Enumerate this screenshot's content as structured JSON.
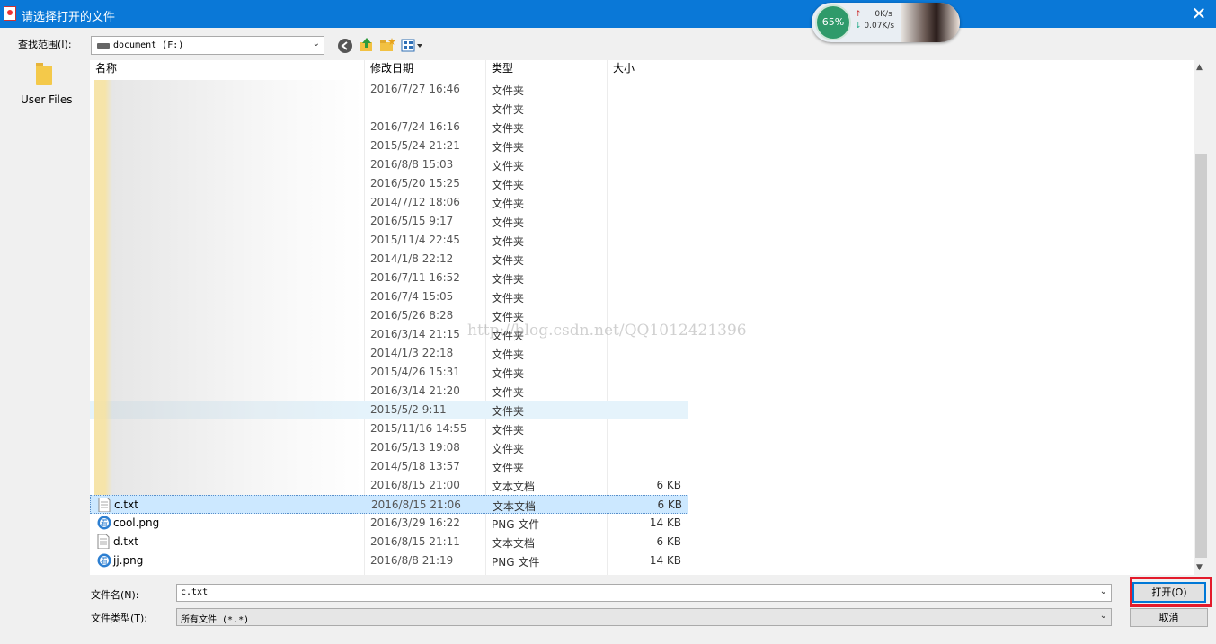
{
  "window": {
    "title": "请选择打开的文件",
    "close_glyph": "✕"
  },
  "net_widget": {
    "percent": "65%",
    "up_speed": "0K/s",
    "down_speed": "0.07K/s",
    "up_arrow": "↑",
    "down_arrow": "↓"
  },
  "toolbar": {
    "look_in_label": "查找范围(I):",
    "look_in_value": "document (F:)"
  },
  "places": {
    "items": [
      {
        "label": "User Files",
        "icon": "folder-icon"
      }
    ]
  },
  "columns": {
    "name": "名称",
    "date": "修改日期",
    "type": "类型",
    "size": "大小"
  },
  "files": [
    {
      "name": "",
      "date": "2016/7/27 16:46",
      "type": "文件夹",
      "size": "",
      "icon": "folder-icon"
    },
    {
      "name": "",
      "date": "",
      "type": "文件夹",
      "size": "",
      "icon": "folder-icon"
    },
    {
      "name": "",
      "date": "2016/7/24 16:16",
      "type": "文件夹",
      "size": "",
      "icon": "folder-icon"
    },
    {
      "name": "",
      "date": "2015/5/24 21:21",
      "type": "文件夹",
      "size": "",
      "icon": "folder-icon"
    },
    {
      "name": "",
      "date": "2016/8/8 15:03",
      "type": "文件夹",
      "size": "",
      "icon": "folder-icon"
    },
    {
      "name": "",
      "date": "2016/5/20 15:25",
      "type": "文件夹",
      "size": "",
      "icon": "folder-icon"
    },
    {
      "name": "",
      "date": "2014/7/12 18:06",
      "type": "文件夹",
      "size": "",
      "icon": "folder-icon"
    },
    {
      "name": "",
      "date": "2016/5/15 9:17",
      "type": "文件夹",
      "size": "",
      "icon": "folder-icon"
    },
    {
      "name": "",
      "date": "2015/11/4 22:45",
      "type": "文件夹",
      "size": "",
      "icon": "folder-icon"
    },
    {
      "name": "",
      "date": "2014/1/8 22:12",
      "type": "文件夹",
      "size": "",
      "icon": "folder-icon"
    },
    {
      "name": "",
      "date": "2016/7/11 16:52",
      "type": "文件夹",
      "size": "",
      "icon": "folder-icon"
    },
    {
      "name": "",
      "date": "2016/7/4 15:05",
      "type": "文件夹",
      "size": "",
      "icon": "folder-icon"
    },
    {
      "name": "",
      "date": "2016/5/26 8:28",
      "type": "文件夹",
      "size": "",
      "icon": "folder-icon"
    },
    {
      "name": "",
      "date": "2016/3/14 21:15",
      "type": "文件夹",
      "size": "",
      "icon": "folder-icon"
    },
    {
      "name": "",
      "date": "2014/1/3 22:18",
      "type": "文件夹",
      "size": "",
      "icon": "folder-icon"
    },
    {
      "name": "",
      "date": "2015/4/26 15:31",
      "type": "文件夹",
      "size": "",
      "icon": "folder-icon"
    },
    {
      "name": "",
      "date": "2016/3/14 21:20",
      "type": "文件夹",
      "size": "",
      "icon": "folder-icon"
    },
    {
      "name": "",
      "date": "2015/5/2 9:11",
      "type": "文件夹",
      "size": "",
      "icon": "folder-icon",
      "state": "hover"
    },
    {
      "name": "",
      "date": "2015/11/16 14:55",
      "type": "文件夹",
      "size": "",
      "icon": "folder-icon"
    },
    {
      "name": "",
      "date": "2016/5/13 19:08",
      "type": "文件夹",
      "size": "",
      "icon": "folder-icon"
    },
    {
      "name": "",
      "date": "2014/5/18 13:57",
      "type": "文件夹",
      "size": "",
      "icon": "folder-icon"
    },
    {
      "name": "",
      "date": "2016/8/15 21:00",
      "type": "文本文档",
      "size": "6 KB",
      "icon": "text-file-icon"
    },
    {
      "name": "c.txt",
      "date": "2016/8/15 21:06",
      "type": "文本文档",
      "size": "6 KB",
      "icon": "text-file-icon",
      "state": "selected"
    },
    {
      "name": "cool.png",
      "date": "2016/3/29 16:22",
      "type": "PNG 文件",
      "size": "14 KB",
      "icon": "image-viewer-icon"
    },
    {
      "name": "d.txt",
      "date": "2016/8/15 21:11",
      "type": "文本文档",
      "size": "6 KB",
      "icon": "text-file-icon"
    },
    {
      "name": "jj.png",
      "date": "2016/8/8 21:19",
      "type": "PNG 文件",
      "size": "14 KB",
      "icon": "image-viewer-icon"
    }
  ],
  "watermark": "http://blog.csdn.net/QQ1012421396",
  "bottom": {
    "filename_label": "文件名(N):",
    "filename_value": "c.txt",
    "filetype_label": "文件类型(T):",
    "filetype_value": "所有文件 (*.*)",
    "open_label": "打开(O)",
    "cancel_label": "取消"
  },
  "colors": {
    "titlebar": "#0a78d7",
    "selection": "#cce8ff",
    "highlight_box": "#e31b2b"
  }
}
